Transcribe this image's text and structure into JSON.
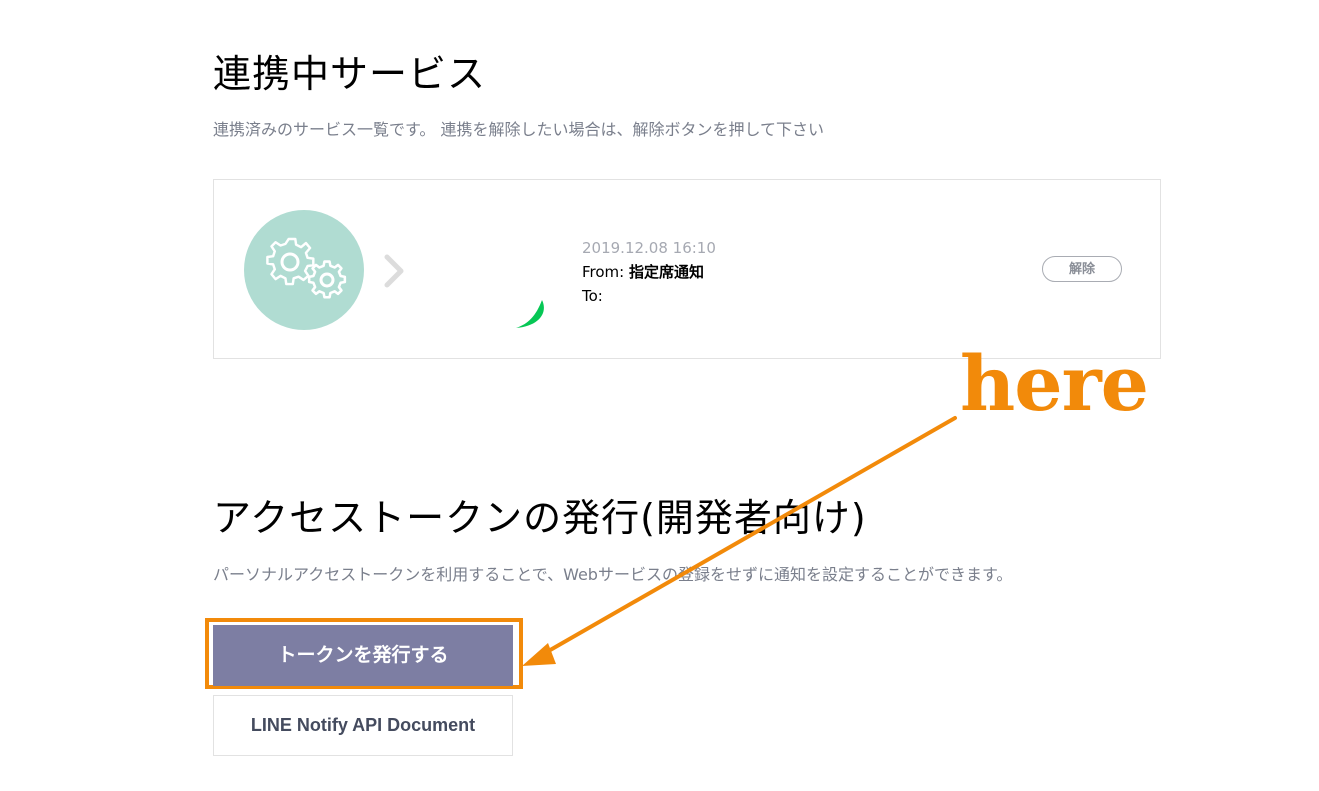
{
  "connected_services": {
    "title": "連携中サービス",
    "description": "連携済みのサービス一覧です。 連携を解除したい場合は、解除ボタンを押して下さい",
    "items": [
      {
        "icon": "gears-icon",
        "date": "2019.12.08 16:10",
        "from_label": "From: ",
        "from_value": "指定席通知",
        "to_label": "To:",
        "unlink_label": "解除"
      }
    ]
  },
  "access_token": {
    "title": "アクセストークンの発行(開発者向け)",
    "description": "パーソナルアクセストークンを利用することで、Webサービスの登録をせずに通知を設定することができます。",
    "issue_button_label": "トークンを発行する",
    "doc_button_label": "LINE Notify API Document"
  },
  "annotation": {
    "label": "here",
    "color": "#f28a0a"
  },
  "colors": {
    "avatar_bg": "#b0dcd2",
    "issue_button_bg": "#7d7ea3",
    "line_green": "#06c755"
  }
}
